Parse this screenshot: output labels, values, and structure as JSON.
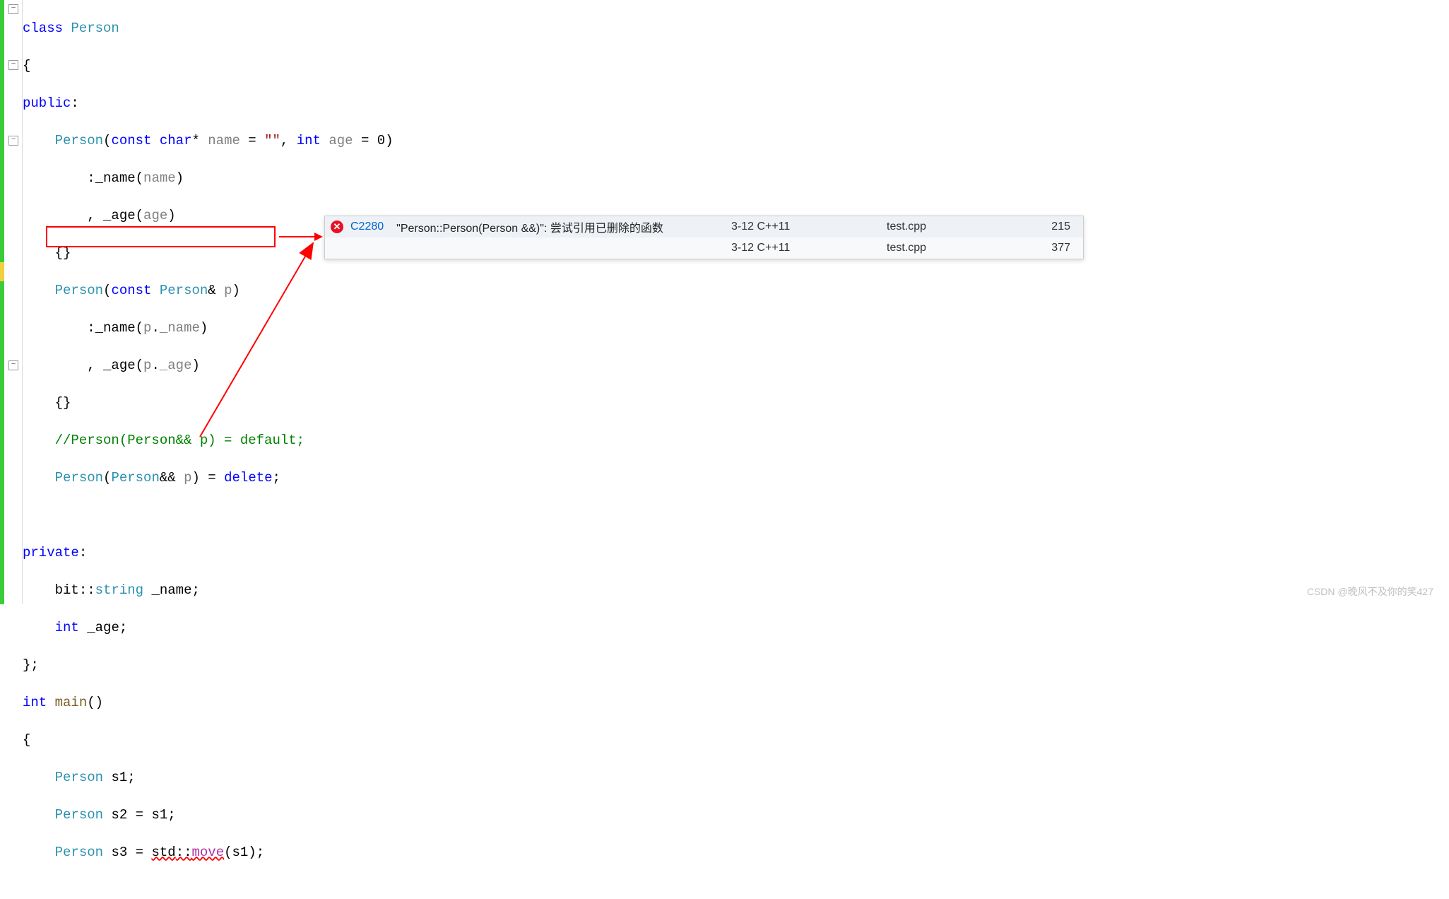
{
  "code": {
    "l1": {
      "kw_class": "class",
      "type_person": "Person"
    },
    "l2": {
      "brace": "{"
    },
    "l3": {
      "kw_public": "public",
      "colon": ":"
    },
    "l4": {
      "type_person": "Person",
      "lparen": "(",
      "kw_const": "const",
      "kw_char": "char",
      "star": "*",
      "param_name": "name",
      "eq": "=",
      "str_empty": "\"\"",
      "comma": ",",
      "kw_int": "int",
      "param_age": "age",
      "eq2": "=",
      "num_zero": "0",
      "rparen": ")"
    },
    "l5": {
      "colon": ":",
      "field": "_name",
      "lparen": "(",
      "arg": "name",
      "rparen": ")"
    },
    "l6": {
      "comma": ",",
      "field": "_age",
      "lparen": "(",
      "arg": "age",
      "rparen": ")"
    },
    "l7": {
      "braces": "{}"
    },
    "l8": {
      "type_person": "Person",
      "lparen": "(",
      "kw_const": "const",
      "type_person2": "Person",
      "amp": "&",
      "param_p": "p",
      "rparen": ")"
    },
    "l9": {
      "colon": ":",
      "field": "_name",
      "lparen": "(",
      "obj": "p",
      "dot": ".",
      "mem": "_name",
      "rparen": ")"
    },
    "l10": {
      "comma": ",",
      "field": "_age",
      "lparen": "(",
      "obj": "p",
      "dot": ".",
      "mem": "_age",
      "rparen": ")"
    },
    "l11": {
      "braces": "{}"
    },
    "l12": {
      "comment": "//Person(Person&& p) = default;"
    },
    "l13": {
      "type_person": "Person",
      "lparen": "(",
      "type_person2": "Person",
      "ampamp": "&&",
      "param_p": "p",
      "rparen": ")",
      "eq": "=",
      "kw_delete": "delete",
      "semi": ";"
    },
    "l14": {
      "blank": ""
    },
    "l15": {
      "kw_private": "private",
      "colon": ":"
    },
    "l16": {
      "ns": "bit",
      "dcolon": "::",
      "type_string": "string",
      "field": "_name",
      "semi": ";"
    },
    "l17": {
      "kw_int": "int",
      "field": "_age",
      "semi": ";"
    },
    "l18": {
      "brace_close": "};"
    },
    "l19": {
      "kw_int": "int",
      "func": "main",
      "parens": "()"
    },
    "l20": {
      "brace": "{"
    },
    "l21": {
      "type_person": "Person",
      "var": "s1",
      "semi": ";"
    },
    "l22": {
      "type_person": "Person",
      "var": "s2",
      "eq": "=",
      "rhs": "s1",
      "semi": ";"
    },
    "l23": {
      "type_person": "Person",
      "var": "s3",
      "eq": "=",
      "ns": "std",
      "dcolon": "::",
      "func": "move",
      "lparen": "(",
      "arg": "s1",
      "rparen": ")",
      "semi": ";"
    }
  },
  "error_panel": {
    "row1": {
      "code": "C2280",
      "msg": "\"Person::Person(Person &&)\": 尝试引用已删除的函数",
      "project": "3-12 C++11",
      "file": "test.cpp",
      "line": "215"
    },
    "row2": {
      "project": "3-12 C++11",
      "file": "test.cpp",
      "line": "377"
    }
  },
  "watermark": "CSDN @晚风不及你的笑427"
}
